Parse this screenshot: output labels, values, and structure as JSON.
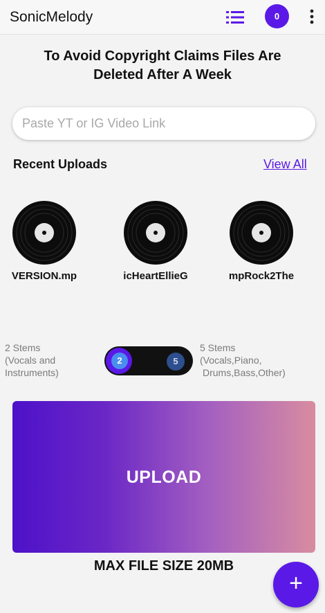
{
  "app": {
    "title": "SonicMelody",
    "badge_count": "0"
  },
  "icons": {
    "list": "list-icon",
    "more": "more-vertical-icon",
    "disc": "vinyl-record-icon",
    "fab": "plus-icon"
  },
  "notice": {
    "line1": "To Avoid Copyright Claims Files Are",
    "line2": "Deleted After A Week"
  },
  "search": {
    "placeholder": "Paste YT or IG Video Link",
    "value": ""
  },
  "recent": {
    "title": "Recent Uploads",
    "view_all": "View All",
    "items": [
      {
        "name": "VERSION.mp"
      },
      {
        "name": "icHeartEllieG"
      },
      {
        "name": "mpRock2The"
      }
    ]
  },
  "stems": {
    "left_line1": "2 Stems",
    "left_line2": "(Vocals and",
    "left_line3": "Instruments)",
    "toggle_left": "2",
    "toggle_right": "5",
    "right_line1": "5 Stems",
    "right_line2": "(Vocals,Piano,",
    "right_line3": "Drums,Bass,Other)",
    "selected": "2"
  },
  "upload": {
    "label": "UPLOAD",
    "max_size": "MAX FILE SIZE 20MB",
    "fab": "+"
  },
  "colors": {
    "accent": "#5a19e6",
    "gradient_start": "#4d12c9",
    "gradient_end": "#d88ca0"
  }
}
